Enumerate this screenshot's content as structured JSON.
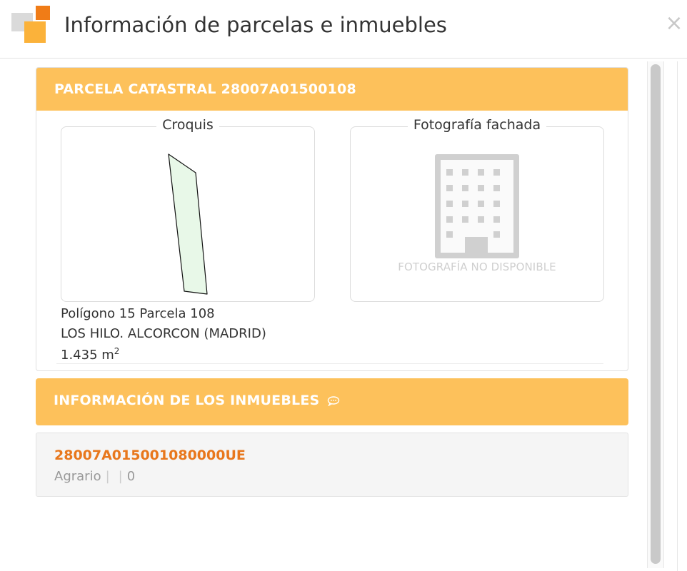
{
  "header": {
    "title": "Información de parcelas e inmuebles",
    "close_symbol": "×",
    "logo_icon": "catastro-logo-icon"
  },
  "parcela": {
    "heading": "PARCELA CATASTRAL 28007A01500108",
    "croquis": {
      "label": "Croquis",
      "fill_color": "#e8f8e8",
      "stroke_color": "#111111"
    },
    "fotografia": {
      "label": "Fotografía fachada",
      "placeholder_icon": "building-icon",
      "placeholder_text": "FOTOGRAFÍA NO DISPONIBLE"
    },
    "poligono": "Polígono 15 Parcela 108",
    "localizacion": "LOS HILO. ALCORCON (MADRID)",
    "superficie_value": "1.435 m",
    "superficie_exp": "2"
  },
  "inmuebles": {
    "heading": "INFORMACIÓN DE LOS INMUEBLES",
    "heading_icon": "speech-bubble-icon",
    "items": [
      {
        "ref": "28007A015001080000UE",
        "uso": "Agrario",
        "campo2": "",
        "campo3": "0"
      }
    ]
  },
  "colors": {
    "accent": "#fdc15b",
    "link": "#e8771c",
    "logo_orange": "#f07c17",
    "logo_yellow": "#fbb23a"
  }
}
